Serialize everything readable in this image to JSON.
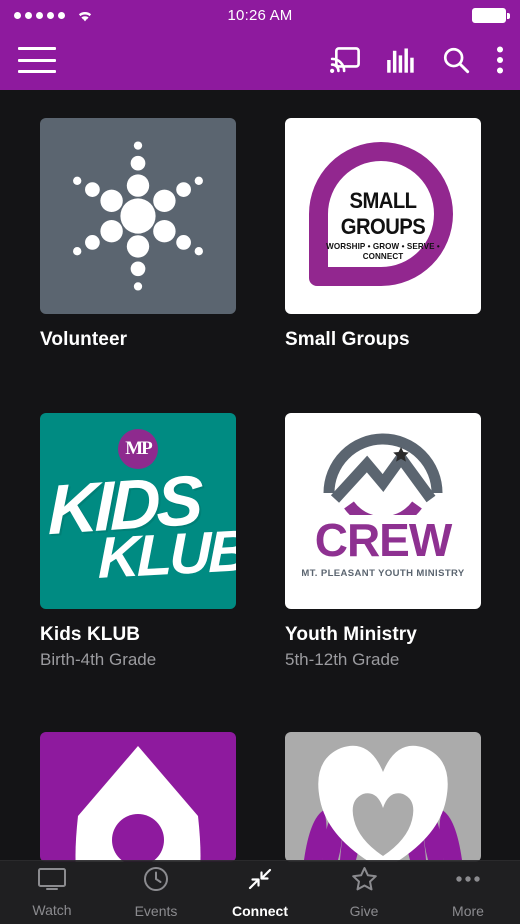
{
  "status_bar": {
    "signal_dots": 5,
    "wifi_icon": "wifi-icon",
    "time": "10:26 AM",
    "battery_icon": "battery-full-icon"
  },
  "nav_bar": {
    "menu_icon": "hamburger-menu-icon",
    "actions": [
      {
        "name": "cast-icon",
        "label": "Cast"
      },
      {
        "name": "equalizer-icon",
        "label": "Audio"
      },
      {
        "name": "search-icon",
        "label": "Search"
      },
      {
        "name": "overflow-menu-icon",
        "label": "More options"
      }
    ]
  },
  "colors": {
    "brand_purple": "#8E1A9E",
    "background": "#141416",
    "volunteer_gray": "#5B6570",
    "kids_teal": "#008B82",
    "crew_purple": "#8E3191",
    "heart_gray": "#ABABAB",
    "subtitle_gray": "#9B9B9F"
  },
  "cards": [
    {
      "title": "Volunteer",
      "subtitle": "",
      "tile_name": "tile-volunteer",
      "logo": "starburst-dots-icon"
    },
    {
      "title": "Small Groups",
      "subtitle": "",
      "tile_name": "tile-small-groups",
      "logo_title": "SMALL GROUPS",
      "logo_tagline": "WORSHIP • GROW • SERVE • CONNECT"
    },
    {
      "title": "Kids KLUB",
      "subtitle": "Birth-4th Grade",
      "tile_name": "tile-kids-klub",
      "logo_badge": "MP",
      "logo_line1": "KIDS",
      "logo_line2": "KLUB"
    },
    {
      "title": "Youth Ministry",
      "subtitle": "5th-12th Grade",
      "tile_name": "tile-youth-ministry",
      "logo_word": "CREW",
      "logo_tagline": "MT. PLEASANT YOUTH MINISTRY"
    },
    {
      "title": "",
      "subtitle": "",
      "tile_name": "tile-row3-left",
      "logo": "house-pin-icon"
    },
    {
      "title": "",
      "subtitle": "",
      "tile_name": "tile-row3-right",
      "logo": "heart-in-hands-icon"
    }
  ],
  "tab_bar": {
    "active": "Connect",
    "tabs": [
      {
        "label": "Watch",
        "icon": "monitor-icon"
      },
      {
        "label": "Events",
        "icon": "clock-icon"
      },
      {
        "label": "Connect",
        "icon": "connect-arrows-icon"
      },
      {
        "label": "Give",
        "icon": "star-icon"
      },
      {
        "label": "More",
        "icon": "ellipsis-icon"
      }
    ]
  }
}
